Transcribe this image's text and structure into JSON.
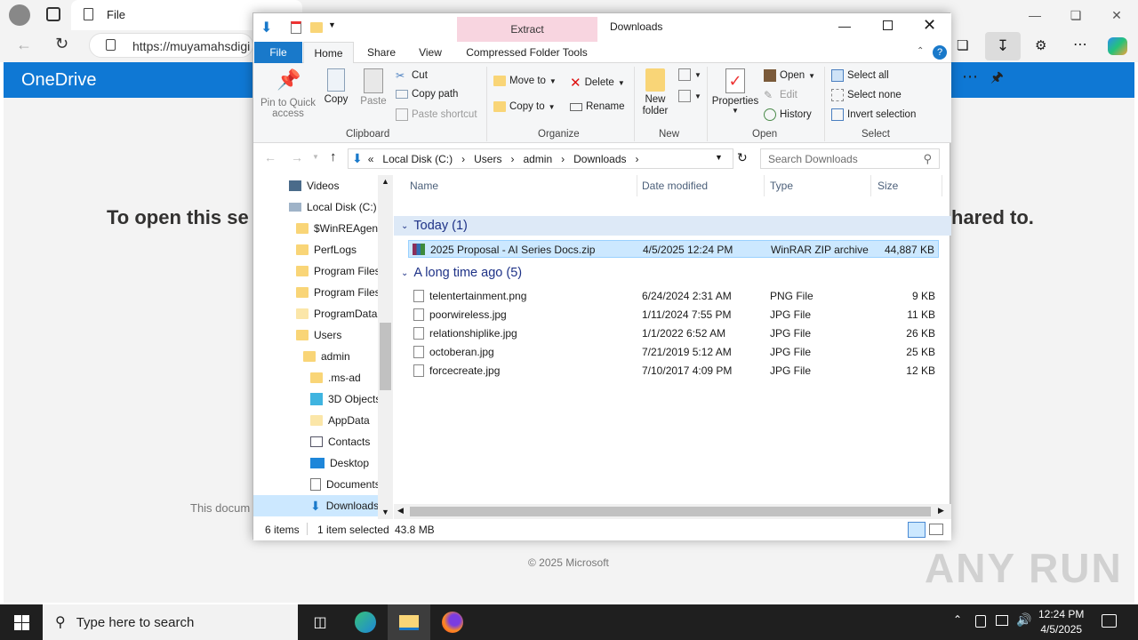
{
  "browser": {
    "tab_title": "File",
    "url": "https://muyamahsdigi",
    "onedrive_brand": "OneDrive",
    "message_left": "To open this se",
    "message_right": "hared to.",
    "doc_text": "This docum",
    "copyright": "© 2025 Microsoft"
  },
  "explorer": {
    "title": "Downloads",
    "context_tab": "Extract",
    "context_tool": "Compressed Folder Tools",
    "tabs": [
      "File",
      "Home",
      "Share",
      "View"
    ],
    "clipboard": {
      "pin_label": "Pin to Quick access",
      "copy_label": "Copy",
      "paste_label": "Paste",
      "cut_label": "Cut",
      "copy_path_label": "Copy path",
      "paste_shortcut_label": "Paste shortcut",
      "group_label": "Clipboard"
    },
    "organize": {
      "move_to": "Move to",
      "copy_to": "Copy to",
      "delete": "Delete",
      "rename": "Rename",
      "group_label": "Organize"
    },
    "new": {
      "new_folder": "New folder",
      "group_label": "New"
    },
    "open": {
      "properties": "Properties",
      "open": "Open",
      "edit": "Edit",
      "history": "History",
      "group_label": "Open"
    },
    "select": {
      "select_all": "Select all",
      "select_none": "Select none",
      "invert": "Invert selection",
      "group_label": "Select"
    },
    "path": [
      "«",
      "Local Disk (C:)",
      "›",
      "Users",
      "›",
      "admin",
      "›",
      "Downloads",
      "›"
    ],
    "search_placeholder": "Search Downloads",
    "tree": [
      "Videos",
      "Local Disk (C:)",
      "$WinREAgent",
      "PerfLogs",
      "Program Files",
      "Program Files",
      "ProgramData",
      "Users",
      "admin",
      ".ms-ad",
      "3D Objects",
      "AppData",
      "Contacts",
      "Desktop",
      "Documents",
      "Downloads"
    ],
    "columns": [
      "Name",
      "Date modified",
      "Type",
      "Size"
    ],
    "group_today": "Today (1)",
    "group_older": "A long time ago (5)",
    "files": [
      {
        "name": "2025 Proposal - AI Series Docs.zip",
        "date": "4/5/2025 12:24 PM",
        "type": "WinRAR ZIP archive",
        "size": "44,887 KB"
      },
      {
        "name": "telentertainment.png",
        "date": "6/24/2024 2:31 AM",
        "type": "PNG File",
        "size": "9 KB"
      },
      {
        "name": "poorwireless.jpg",
        "date": "1/11/2024 7:55 PM",
        "type": "JPG File",
        "size": "11 KB"
      },
      {
        "name": "relationshiplike.jpg",
        "date": "1/1/2022 6:52 AM",
        "type": "JPG File",
        "size": "26 KB"
      },
      {
        "name": "octoberan.jpg",
        "date": "7/21/2019 5:12 AM",
        "type": "JPG File",
        "size": "25 KB"
      },
      {
        "name": "forcecreate.jpg",
        "date": "7/10/2017 4:09 PM",
        "type": "JPG File",
        "size": "12 KB"
      }
    ],
    "status_count": "6 items",
    "status_selected": "1 item selected",
    "status_size": "43.8 MB"
  },
  "taskbar": {
    "search_placeholder": "Type here to search",
    "time": "12:24 PM",
    "date": "4/5/2025"
  },
  "watermark": "ANY RUN",
  "colors": {
    "accent": "#1979ca",
    "onedrive": "#0f78d4",
    "extract_tab": "#f8d5e0",
    "selection": "#cce8ff"
  }
}
